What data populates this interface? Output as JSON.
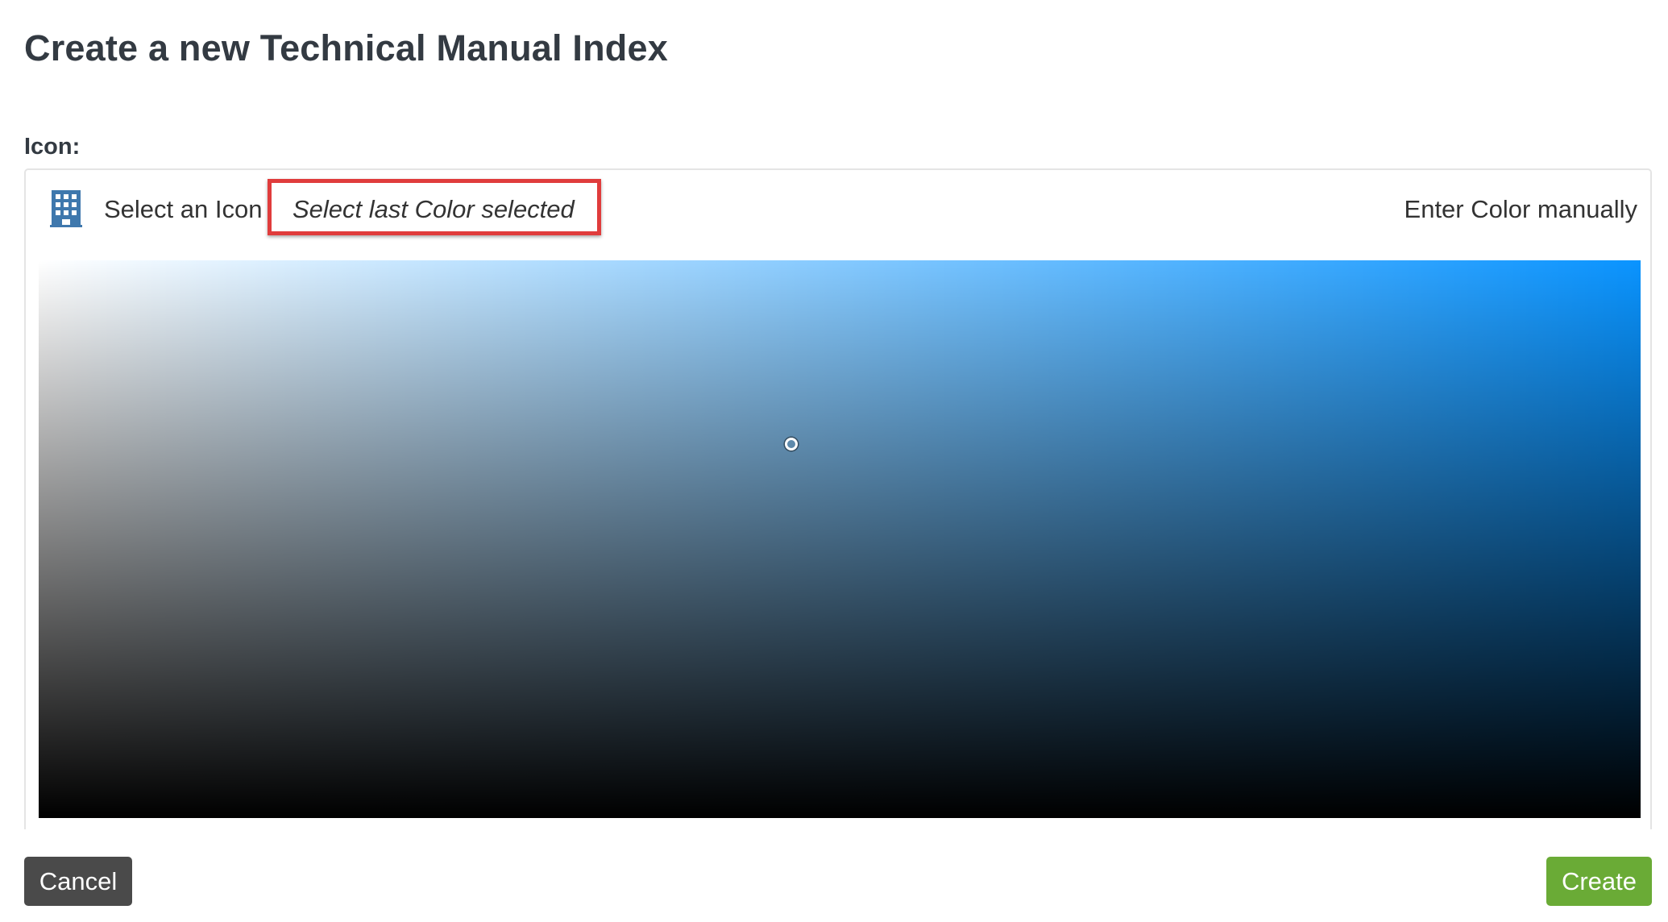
{
  "page": {
    "title": "Create a new Technical Manual Index"
  },
  "icon_field": {
    "label": "Icon:",
    "icon_name": "building-icon",
    "icon_color": "#3f78ad",
    "select_icon_label": "Select an Icon",
    "last_color_label": "Select last Color selected",
    "enter_color_label": "Enter Color manually"
  },
  "color_picker": {
    "hue_color": "#0a94ff",
    "saturation": 0.47,
    "brightness": 0.67
  },
  "footer": {
    "cancel_label": "Cancel",
    "create_label": "Create"
  },
  "colors": {
    "highlight_border": "#e03c3c",
    "cancel_button": "#4a4a4a",
    "create_button": "#6aab36"
  }
}
